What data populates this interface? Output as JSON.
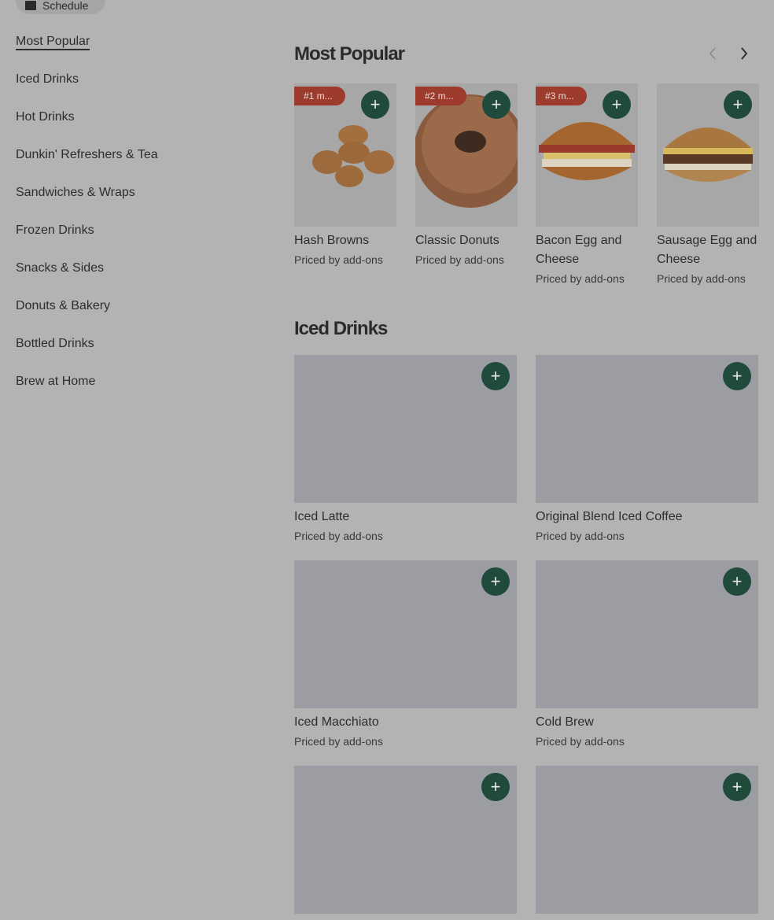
{
  "header": {
    "schedule_label": "Schedule"
  },
  "sidebar": {
    "items": [
      {
        "label": "Most Popular"
      },
      {
        "label": "Iced Drinks"
      },
      {
        "label": "Hot Drinks"
      },
      {
        "label": "Dunkin' Refreshers & Tea"
      },
      {
        "label": "Sandwiches & Wraps"
      },
      {
        "label": "Frozen Drinks"
      },
      {
        "label": "Snacks & Sides"
      },
      {
        "label": "Donuts & Bakery"
      },
      {
        "label": "Bottled Drinks"
      },
      {
        "label": "Brew at Home"
      }
    ]
  },
  "most_popular": {
    "title": "Most Popular",
    "items": [
      {
        "rank": "#1 m...",
        "name": "Hash Browns",
        "price": "Priced by add-ons",
        "image": "hash-browns"
      },
      {
        "rank": "#2 m...",
        "name": "Classic Donuts",
        "price": "Priced by add-ons",
        "image": "donut"
      },
      {
        "rank": "#3 m...",
        "name": "Bacon Egg and Cheese",
        "price": "Priced by add-ons",
        "image": "bagel-sandwich"
      },
      {
        "rank": "",
        "name": "Sausage Egg and Cheese",
        "price": "Priced by add-ons",
        "image": "sausage-sandwich"
      }
    ]
  },
  "iced_drinks": {
    "title": "Iced Drinks",
    "items": [
      {
        "name": "Iced Latte",
        "price": "Priced by add-ons"
      },
      {
        "name": "Original Blend Iced Coffee",
        "price": "Priced by add-ons"
      },
      {
        "name": "Iced Macchiato",
        "price": "Priced by add-ons"
      },
      {
        "name": "Cold Brew",
        "price": "Priced by add-ons"
      },
      {
        "name": "",
        "price": ""
      },
      {
        "name": "",
        "price": ""
      }
    ]
  },
  "icons": {
    "add": "plus-icon",
    "prev": "chevron-left-icon",
    "next": "chevron-right-icon"
  },
  "colors": {
    "add_button": "#1f4a3c",
    "badge": "#9d3b2c",
    "overlay_bg": "#b3b3b3"
  }
}
